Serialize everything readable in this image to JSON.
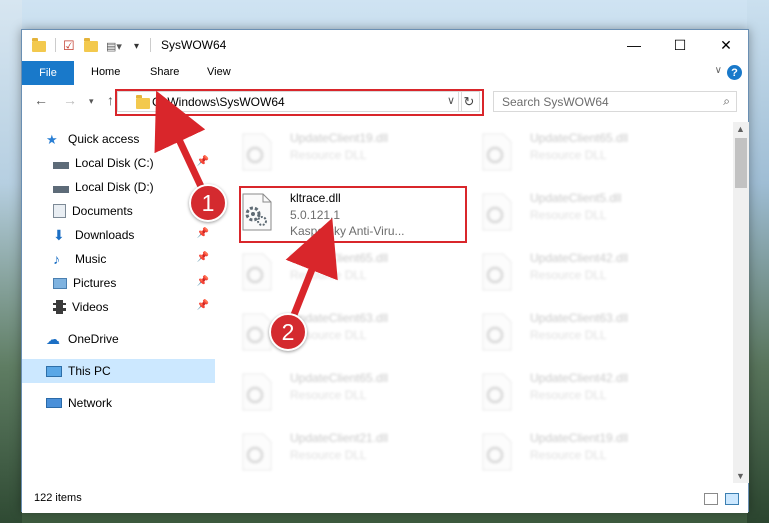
{
  "window": {
    "title": "SysWOW64",
    "controls": {
      "minimize": "—",
      "maximize": "☐",
      "close": "✕"
    }
  },
  "ribbon": {
    "tabs": [
      "File",
      "Home",
      "Share",
      "View"
    ],
    "help": "?"
  },
  "nav": {
    "address": "C:\\Windows\\SysWOW64",
    "search_placeholder": "Search SysWOW64"
  },
  "sidebar": {
    "items": [
      {
        "label": "Quick access",
        "icon": "star-icon"
      },
      {
        "label": "Local Disk (C:)",
        "icon": "drive-icon",
        "pinned": true
      },
      {
        "label": "Local Disk (D:)",
        "icon": "drive-icon",
        "pinned": true
      },
      {
        "label": "Documents",
        "icon": "documents-icon",
        "pinned": true
      },
      {
        "label": "Downloads",
        "icon": "download-icon",
        "pinned": true
      },
      {
        "label": "Music",
        "icon": "music-icon",
        "pinned": true
      },
      {
        "label": "Pictures",
        "icon": "pictures-icon",
        "pinned": true
      },
      {
        "label": "Videos",
        "icon": "videos-icon",
        "pinned": true
      },
      {
        "label": "OneDrive",
        "icon": "cloud-icon"
      },
      {
        "label": "This PC",
        "icon": "computer-icon",
        "selected": true
      },
      {
        "label": "Network",
        "icon": "network-icon"
      }
    ]
  },
  "files": [
    {
      "name": "UpdateClient19.dll",
      "type": "Resource DLL"
    },
    {
      "name": "UpdateClient65.dll",
      "type": "Resource DLL"
    },
    {
      "name": "kltrace.dll",
      "version": "5.0.121.1",
      "company": "Kaspersky Anti-Viru...",
      "highlighted": true
    },
    {
      "name": "UpdateClient5.dll",
      "type": "Resource DLL"
    },
    {
      "name": "UpdateClient65.dll",
      "type": "Resource DLL"
    },
    {
      "name": "UpdateClient42.dll",
      "type": "Resource DLL"
    },
    {
      "name": "UpdateClient63.dll",
      "type": "Resource DLL"
    },
    {
      "name": "UpdateClient63.dll",
      "type": "Resource DLL"
    },
    {
      "name": "UpdateClient65.dll",
      "type": "Resource DLL"
    },
    {
      "name": "UpdateClient42.dll",
      "type": "Resource DLL"
    },
    {
      "name": "UpdateClient21.dll",
      "type": "Resource DLL"
    },
    {
      "name": "UpdateClient19.dll",
      "type": "Resource DLL"
    }
  ],
  "status": {
    "item_count": "122 items"
  },
  "annotations": {
    "step1": "1",
    "step2": "2",
    "color": "#d9262b"
  }
}
